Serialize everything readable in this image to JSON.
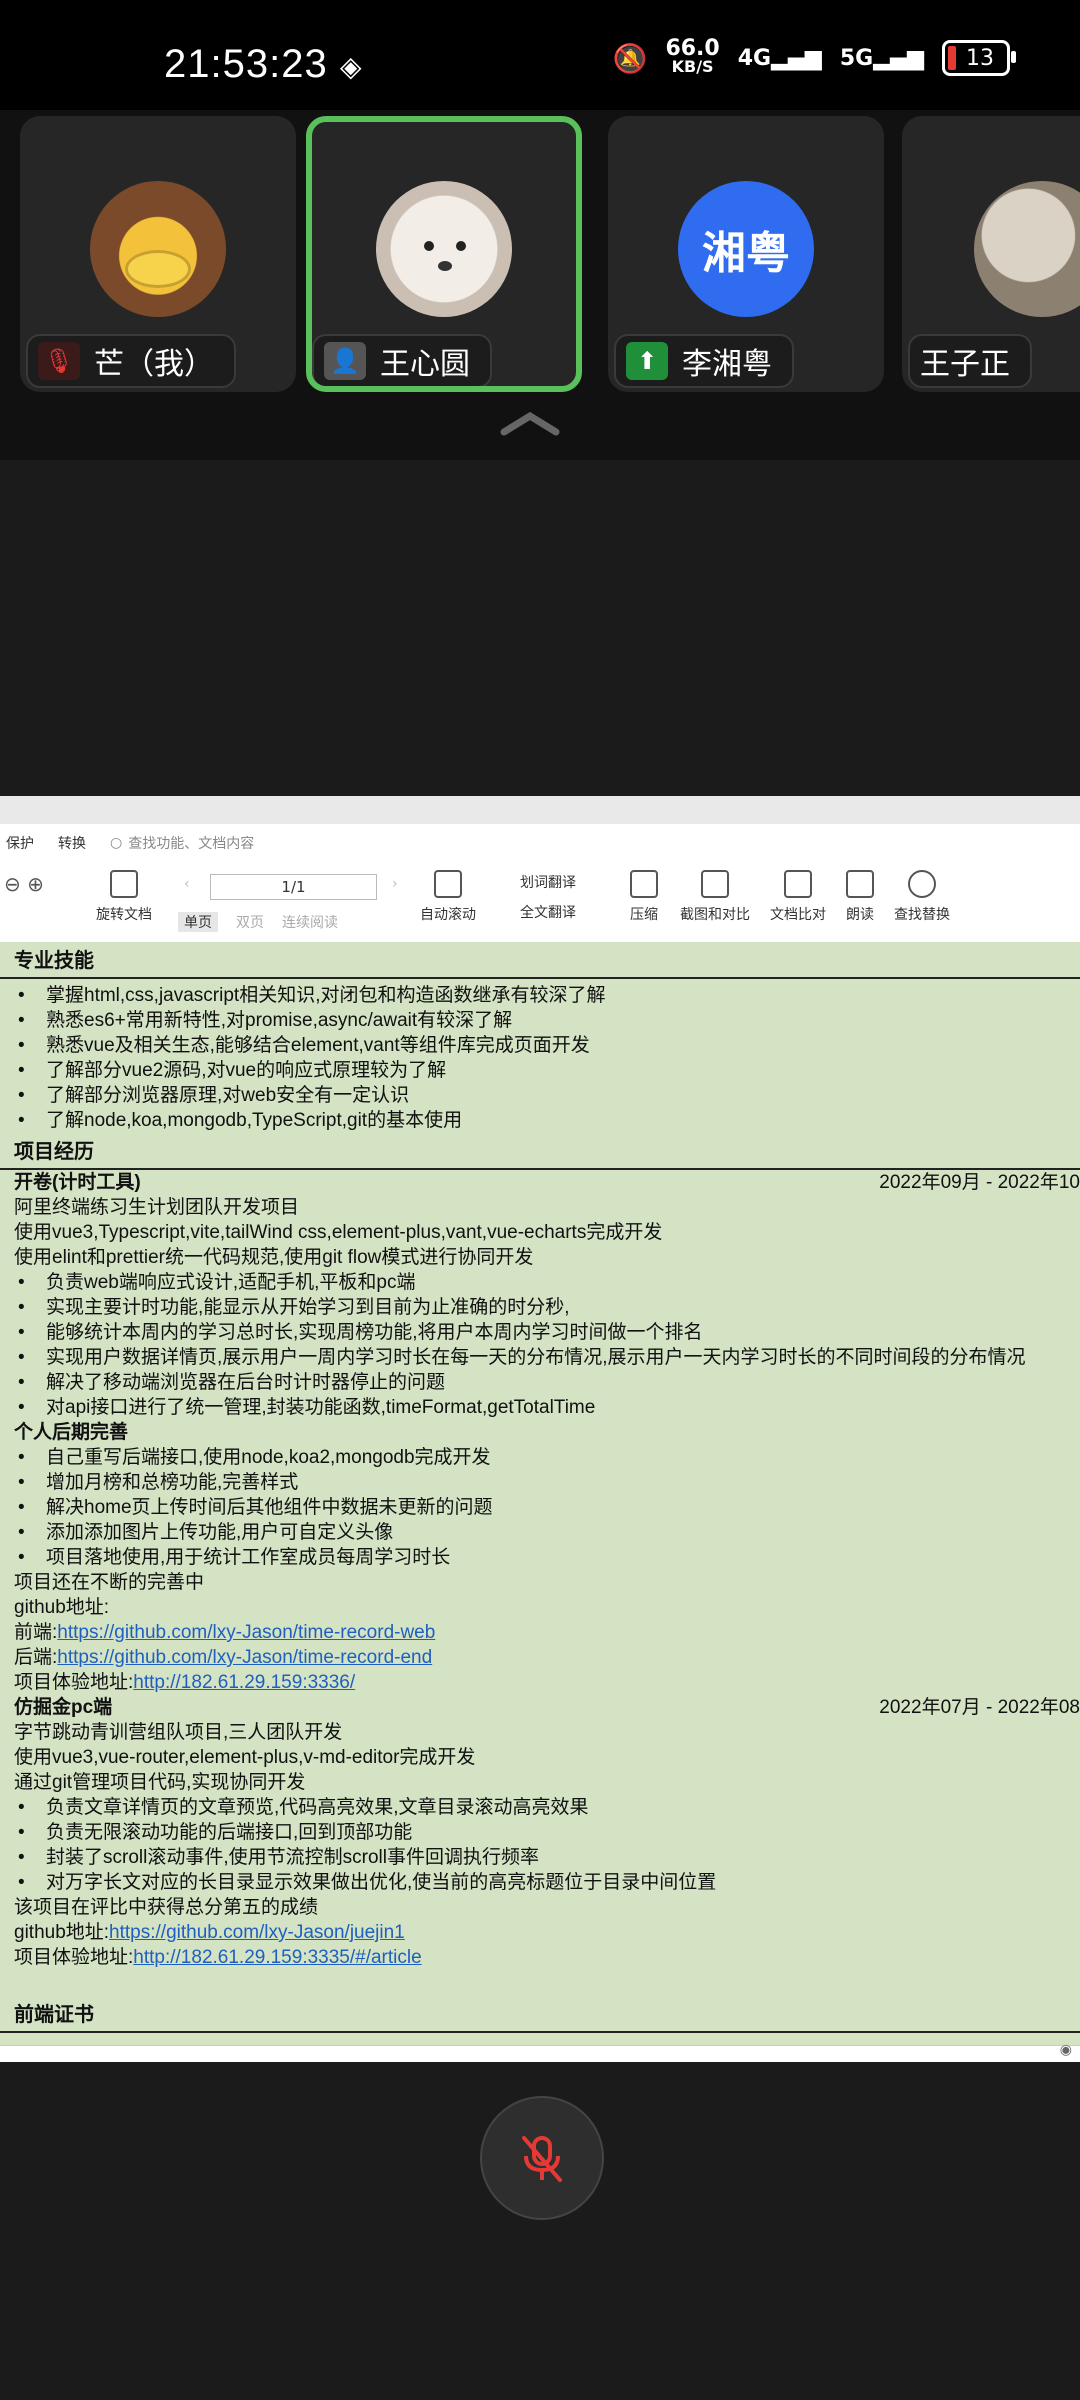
{
  "status": {
    "time": "21:53:23",
    "net_speed": "66.0",
    "net_unit": "KB/S",
    "net1": "4G",
    "net2": "5G",
    "battery": "13"
  },
  "participants": [
    {
      "name": "芒（我）",
      "avatar_text": "",
      "muted": true
    },
    {
      "name": "王心圆",
      "avatar_text": "",
      "active": true
    },
    {
      "name": "李湘粤",
      "avatar_text": "湘粤",
      "sharing": true
    },
    {
      "name": "王子正",
      "avatar_text": ""
    }
  ],
  "doc": {
    "menu": [
      "保护",
      "转换"
    ],
    "search_placeholder": "查找功能、文档内容",
    "page": "1/1",
    "tools": {
      "rotate": "旋转文档",
      "single": "单页",
      "double": "双页",
      "continuous": "连续阅读",
      "autoscroll": "自动滚动",
      "select_translate": "划词翻译",
      "full_translate": "全文翻译",
      "compress": "压缩",
      "screenshot": "截图和对比",
      "compare": "文档比对",
      "read": "朗读",
      "find_replace": "查找替换"
    },
    "sections": {
      "skills_title": "专业技能",
      "skills": [
        "掌握html,css,javascript相关知识,对闭包和构造函数继承有较深了解",
        "熟悉es6+常用新特性,对promise,async/await有较深了解",
        "熟悉vue及相关生态,能够结合element,vant等组件库完成页面开发",
        "了解部分vue2源码,对vue的响应式原理较为了解",
        "了解部分浏览器原理,对web安全有一定认识",
        "了解node,koa,mongodb,TypeScript,git的基本使用"
      ],
      "projects_title": "项目经历",
      "p1_title": "开卷(计时工具)",
      "p1_date": "2022年09月  - 2022年10",
      "p1_lines": [
        "阿里终端练习生计划团队开发项目",
        "使用vue3,Typescript,vite,tailWind css,element-plus,vant,vue-echarts完成开发",
        "使用elint和prettier统一代码规范,使用git flow模式进行协同开发"
      ],
      "p1_bullets": [
        "负责web端响应式设计,适配手机,平板和pc端",
        "实现主要计时功能,能显示从开始学习到目前为止准确的时分秒,",
        "能够统计本周内的学习总时长,实现周榜功能,将用户本周内学习时间做一个排名",
        "实现用户数据详情页,展示用户一周内学习时长在每一天的分布情况,展示用户一天内学习时长的不同时间段的分布情况",
        "解决了移动端浏览器在后台时计时器停止的问题",
        "对api接口进行了统一管理,封装功能函数,timeFormat,getTotalTime"
      ],
      "p1_sub_title": "个人后期完善",
      "p1_sub_bullets": [
        "自己重写后端接口,使用node,koa2,mongodb完成开发",
        "增加月榜和总榜功能,完善样式",
        "解决home页上传时间后其他组件中数据未更新的问题",
        "添加添加图片上传功能,用户可自定义头像",
        "项目落地使用,用于统计工作室成员每周学习时长"
      ],
      "p1_tail": [
        "项目还在不断的完善中",
        "github地址:"
      ],
      "p1_front_label": "前端:",
      "p1_front_link": "https://github.com/lxy-Jason/time-record-web",
      "p1_back_label": "后端:",
      "p1_back_link": "https://github.com/lxy-Jason/time-record-end",
      "p1_demo_label": "项目体验地址:",
      "p1_demo_link": "http://182.61.29.159:3336/",
      "p2_title": "仿掘金pc端",
      "p2_date": "2022年07月  - 2022年08",
      "p2_lines": [
        "字节跳动青训营组队项目,三人团队开发",
        "使用vue3,vue-router,element-plus,v-md-editor完成开发",
        "通过git管理项目代码,实现协同开发"
      ],
      "p2_bullets": [
        "负责文章详情页的文章预览,代码高亮效果,文章目录滚动高亮效果",
        "负责无限滚动功能的后端接口,回到顶部功能",
        "封装了scroll滚动事件,使用节流控制scroll事件回调执行频率",
        "对万字长文对应的长目录显示效果做出优化,使当前的高亮标题位于目录中间位置"
      ],
      "p2_tail": "该项目在评比中获得总分第五的成绩",
      "p2_github_label": "github地址:",
      "p2_github_link": "https://github.com/lxy-Jason/juejin1",
      "p2_demo_label": "项目体验地址:",
      "p2_demo_link": "http://182.61.29.159:3335/#/article",
      "cert_title": "前端证书"
    }
  }
}
